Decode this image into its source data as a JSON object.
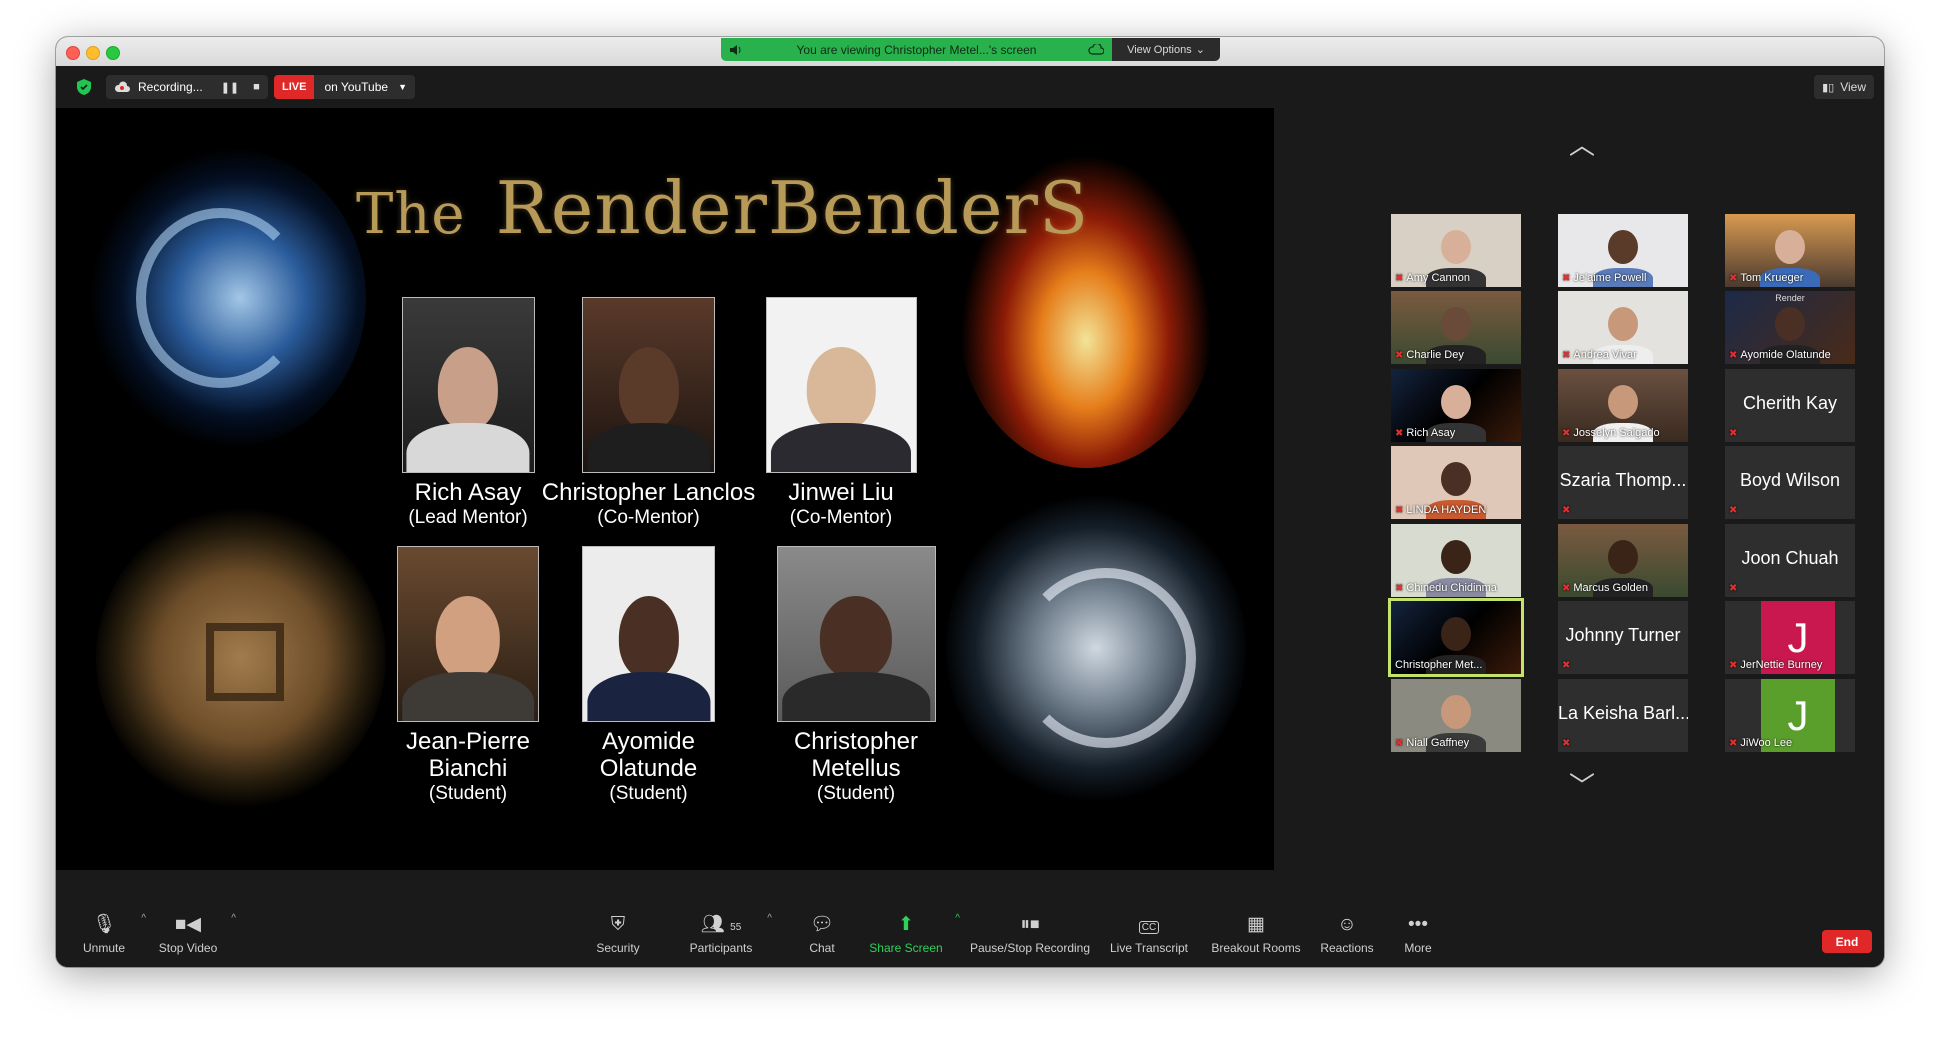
{
  "banner": {
    "message": "You are viewing Christopher Metel...'s screen",
    "view_options": "View Options"
  },
  "topbar": {
    "recording": "Recording...",
    "live": "LIVE",
    "live_target": "on YouTube",
    "view": "View"
  },
  "slide": {
    "title_prefix": "The",
    "title_main": "RenderBenderS",
    "people": [
      {
        "name": "Rich Asay",
        "role": "(Lead Mentor)"
      },
      {
        "name": "Christopher Lanclos",
        "role": "(Co-Mentor)"
      },
      {
        "name": "Jinwei Liu",
        "role": "(Co-Mentor)"
      },
      {
        "name": "Jean-Pierre Bianchi",
        "role": "(Student)"
      },
      {
        "name": "Ayomide Olatunde",
        "role": "(Student)"
      },
      {
        "name": "Christopher Metellus",
        "role": "(Student)"
      }
    ]
  },
  "gallery": {
    "tiles": [
      {
        "name": "Amy Cannon"
      },
      {
        "name": "Je'aime Powell"
      },
      {
        "name": "Tom Krueger"
      },
      {
        "name": "Charlie Dey"
      },
      {
        "name": "Andrea Vivar"
      },
      {
        "name": "Ayomide Olatunde"
      },
      {
        "name": "Rich Asay"
      },
      {
        "name": "Josselyn Salgado"
      },
      {
        "name": "Cherith Kay"
      },
      {
        "name": "LINDA HAYDEN"
      },
      {
        "name": "Szaria Thomp..."
      },
      {
        "name": "Boyd Wilson"
      },
      {
        "name": "Chinedu Chidinma"
      },
      {
        "name": "Marcus Golden"
      },
      {
        "name": "Joon Chuah"
      },
      {
        "name": "Christopher Met..."
      },
      {
        "name": "Johnny Turner"
      },
      {
        "name": "JerNettie Burney",
        "letter": "J"
      },
      {
        "name": "Niall Gaffney"
      },
      {
        "name": "La Keisha Barl..."
      },
      {
        "name": "JiWoo Lee",
        "letter": "J"
      }
    ],
    "tile_label": "Render"
  },
  "toolbar": {
    "unmute": "Unmute",
    "stop_video": "Stop Video",
    "security": "Security",
    "participants": "Participants",
    "participants_count": "55",
    "chat": "Chat",
    "share_screen": "Share Screen",
    "pause_stop_recording": "Pause/Stop Recording",
    "live_transcript": "Live Transcript",
    "breakout_rooms": "Breakout Rooms",
    "reactions": "Reactions",
    "more": "More",
    "end": "End",
    "cc_label": "CC"
  },
  "colors": {
    "accent_green": "#2ed15a",
    "end_red": "#e02828",
    "jernettie_bg": "#c8184f",
    "jiwoo_bg": "#5a9e2c",
    "active_border": "#c3e36a"
  }
}
